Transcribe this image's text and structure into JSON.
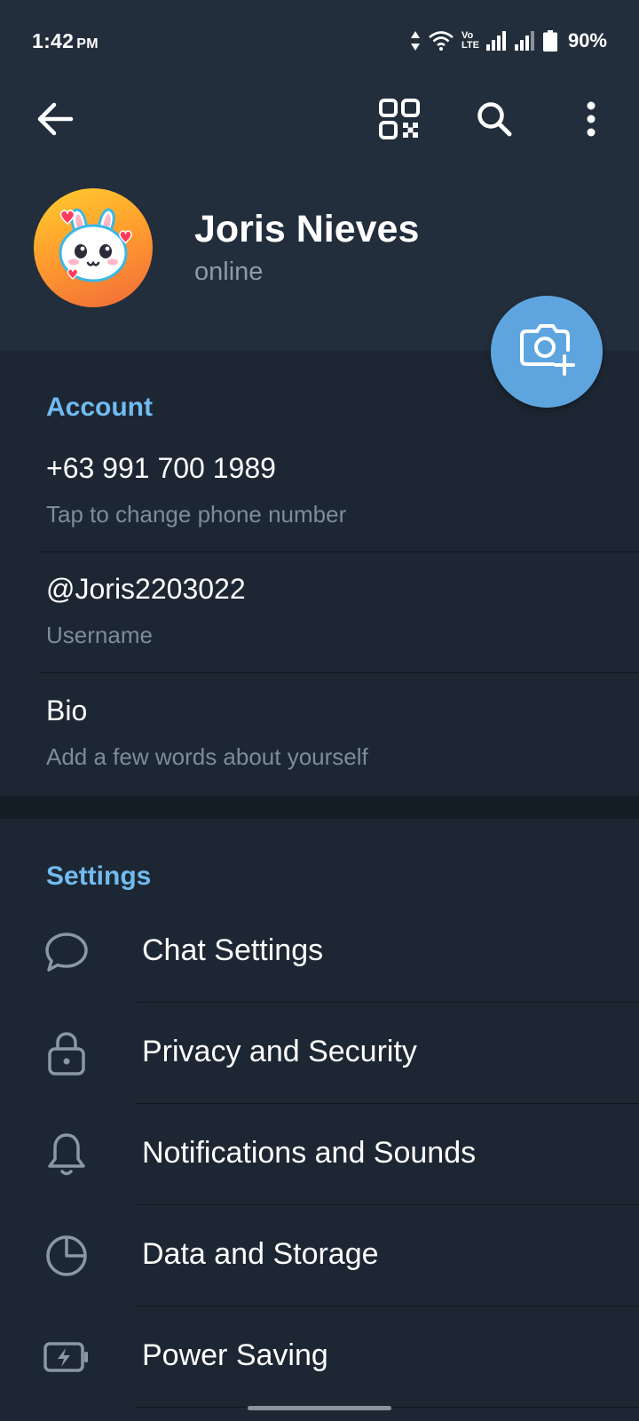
{
  "status_bar": {
    "time": "1:42",
    "ampm": "PM",
    "net_tag_top": "Vo",
    "net_tag_bottom": "LTE",
    "battery_percent": "90%"
  },
  "toolbar": {
    "back_icon": "arrow-left-icon",
    "qr_icon": "qr-code-icon",
    "search_icon": "search-icon",
    "menu_icon": "more-vertical-icon"
  },
  "profile": {
    "name": "Joris Nieves",
    "status": "online",
    "camera_icon": "camera-add-icon"
  },
  "account": {
    "title": "Account",
    "items": [
      {
        "value": "+63 991 700 1989",
        "hint": "Tap to change phone number"
      },
      {
        "value": "@Joris2203022",
        "hint": "Username"
      },
      {
        "value": "Bio",
        "hint": "Add a few words about yourself"
      }
    ]
  },
  "settings": {
    "title": "Settings",
    "items": [
      {
        "label": "Chat Settings",
        "icon": "chat-bubble-icon"
      },
      {
        "label": "Privacy and Security",
        "icon": "lock-icon"
      },
      {
        "label": "Notifications and Sounds",
        "icon": "bell-icon"
      },
      {
        "label": "Data and Storage",
        "icon": "pie-chart-icon"
      },
      {
        "label": "Power Saving",
        "icon": "battery-bolt-icon"
      }
    ]
  },
  "colors": {
    "header_bg": "#232e3c",
    "body_bg": "#1d2733",
    "accent": "#71bbf0",
    "fab": "#5ea5e0"
  }
}
